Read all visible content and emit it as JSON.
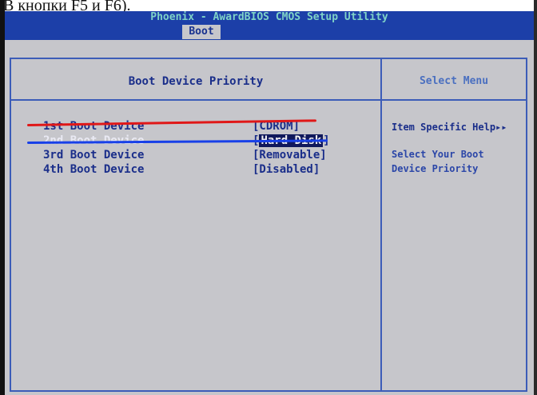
{
  "caption": "В кнопки F5 и F6).",
  "bios": {
    "title": "Phoenix - AwardBIOS CMOS Setup Utility",
    "active_tab": "Boot",
    "panel_title": "Boot Device Priority",
    "help_header": "Select Menu",
    "help_specific": "Item Specific Help▸▸",
    "help_desc_1": "Select Your Boot",
    "help_desc_2": "Device Priority"
  },
  "boot_devices": [
    {
      "label": "1st Boot Device",
      "value": "[CDROM]"
    },
    {
      "label": "2nd Boot Device",
      "value_open": "[",
      "value_sel": "Hard Disk",
      "value_close": "]"
    },
    {
      "label": "3rd Boot Device",
      "value": "[Removable]"
    },
    {
      "label": "4th Boot Device",
      "value": "[Disabled]"
    }
  ],
  "annotation_colors": {
    "red": "#e01818",
    "blue": "#1840e8"
  }
}
